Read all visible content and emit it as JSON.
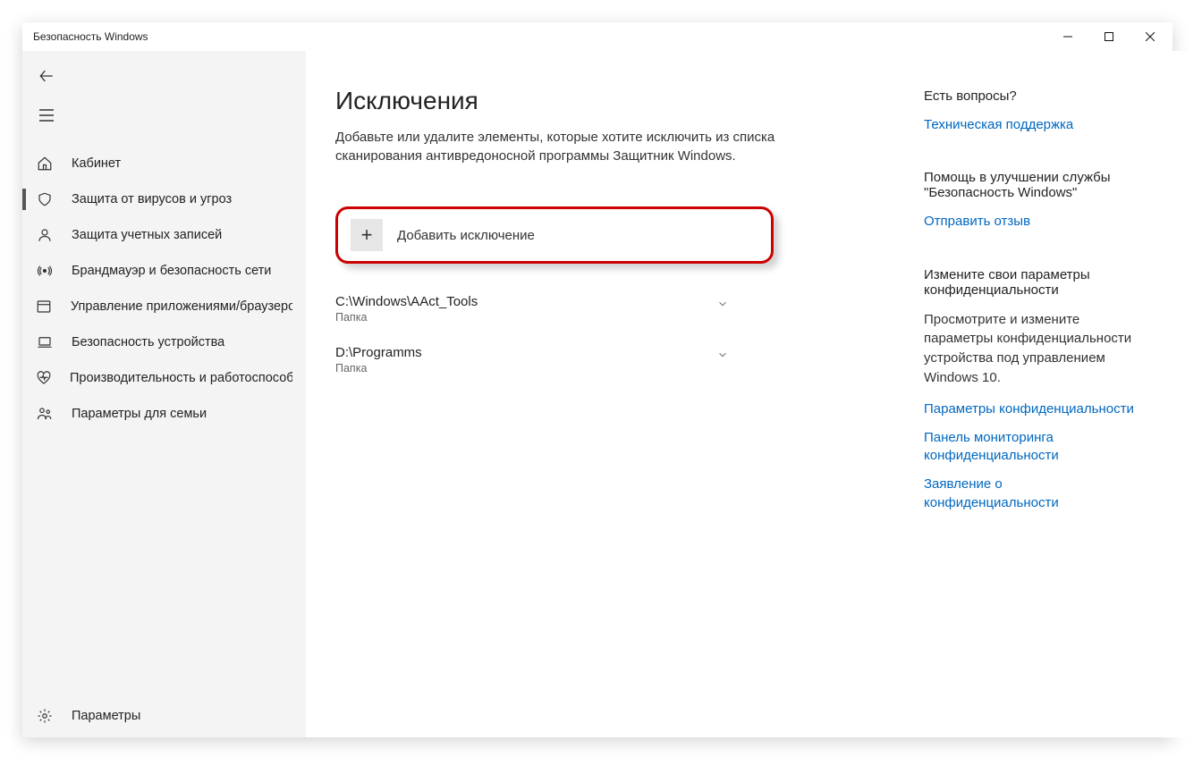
{
  "window": {
    "title": "Безопасность Windows"
  },
  "sidebar": {
    "items": [
      {
        "name": "home",
        "icon": "home",
        "label": "Кабинет"
      },
      {
        "name": "virus",
        "icon": "shield",
        "label": "Защита от вирусов и угроз",
        "selected": true
      },
      {
        "name": "account",
        "icon": "person",
        "label": "Защита учетных записей"
      },
      {
        "name": "firewall",
        "icon": "wifi",
        "label": "Брандмауэр и безопасность сети"
      },
      {
        "name": "app-browser",
        "icon": "app",
        "label": "Управление приложениями/браузером"
      },
      {
        "name": "device-security",
        "icon": "laptop",
        "label": "Безопасность устройства"
      },
      {
        "name": "device-performance",
        "icon": "heart",
        "label": "Производительность и работоспособность устройства"
      },
      {
        "name": "family",
        "icon": "family",
        "label": "Параметры для семьи"
      }
    ],
    "footer": {
      "name": "settings",
      "icon": "gear",
      "label": "Параметры"
    }
  },
  "content": {
    "title": "Исключения",
    "description": "Добавьте или удалите элементы, которые хотите исключить из списка сканирования антивредоносной программы Защитник Windows.",
    "add_button": "Добавить исключение",
    "exclusions": [
      {
        "path": "C:\\Windows\\AAct_Tools",
        "type": "Папка"
      },
      {
        "path": "D:\\Programms",
        "type": "Папка"
      }
    ]
  },
  "aside": {
    "help": {
      "title": "Есть вопросы?",
      "link": "Техническая поддержка"
    },
    "feedback": {
      "title": "Помощь в улучшении службы \"Безопасность Windows\"",
      "link": "Отправить отзыв"
    },
    "privacy": {
      "title": "Измените свои параметры конфиденциальности",
      "description": "Просмотрите и измените параметры конфиденциальности устройства под управлением Windows 10.",
      "links": [
        "Параметры конфиденциальности",
        "Панель мониторинга конфиденциальности",
        "Заявление о конфиденциальности"
      ]
    }
  }
}
